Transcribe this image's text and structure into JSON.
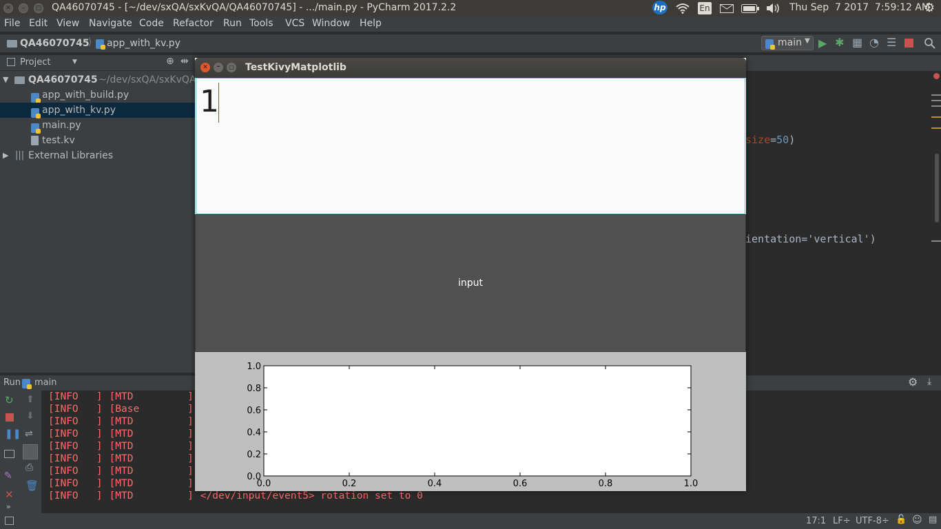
{
  "system_bar": {
    "window_title": "QA46070745 - [~/dev/sxQA/sxKvQA/QA46070745] - .../main.py - PyCharm 2017.2.2",
    "keyboard_layout": "En",
    "clock": "Thu Sep  7 2017  7:59:12 AM"
  },
  "menu": {
    "items": [
      "File",
      "Edit",
      "View",
      "Navigate",
      "Code",
      "Refactor",
      "Run",
      "Tools",
      "VCS",
      "Window",
      "Help"
    ]
  },
  "navbar": {
    "breadcrumb_project": "QA46070745",
    "breadcrumb_file": "app_with_kv.py",
    "run_config": "main"
  },
  "project_panel": {
    "header": "Project",
    "root_name": "QA46070745",
    "root_path": "~/dev/sxQA/sxKvQA",
    "files": [
      "app_with_build.py",
      "app_with_kv.py",
      "main.py",
      "test.kv"
    ],
    "selected_file": "app_with_kv.py",
    "external": "External Libraries"
  },
  "editor": {
    "line_a_pre": "size",
    "line_a_eq": "=",
    "line_a_num": "50",
    "line_a_post": ")",
    "line_b": "ientation='vertical')"
  },
  "run_panel": {
    "header_label": "Run",
    "config": "main",
    "log_lines": [
      {
        "level": "[INFO   ]",
        "module": "[MTD         ]",
        "msg": ""
      },
      {
        "level": "[INFO   ]",
        "module": "[Base        ]",
        "msg": ""
      },
      {
        "level": "[INFO   ]",
        "module": "[MTD         ]",
        "msg": ""
      },
      {
        "level": "[INFO   ]",
        "module": "[MTD         ]",
        "msg": ""
      },
      {
        "level": "[INFO   ]",
        "module": "[MTD         ]",
        "msg": ""
      },
      {
        "level": "[INFO   ]",
        "module": "[MTD         ]",
        "msg": ""
      },
      {
        "level": "[INFO   ]",
        "module": "[MTD         ]",
        "msg": ""
      },
      {
        "level": "[INFO   ]",
        "module": "[MTD         ]",
        "msg": ""
      },
      {
        "level": "[INFO   ]",
        "module": "[MTD         ]",
        "msg": "</dev/input/event5> rotation set to 0"
      }
    ]
  },
  "status_bar": {
    "position": "17:1",
    "line_sep": "LF÷",
    "encoding": "UTF-8÷"
  },
  "kivy_window": {
    "title": "TestKivyMatplotlib",
    "text_value": "1",
    "button_label": "input",
    "plot": {
      "x_ticks": [
        "0.0",
        "0.2",
        "0.4",
        "0.6",
        "0.8",
        "1.0"
      ],
      "y_ticks": [
        "0.0",
        "0.2",
        "0.4",
        "0.6",
        "0.8",
        "1.0"
      ]
    }
  }
}
